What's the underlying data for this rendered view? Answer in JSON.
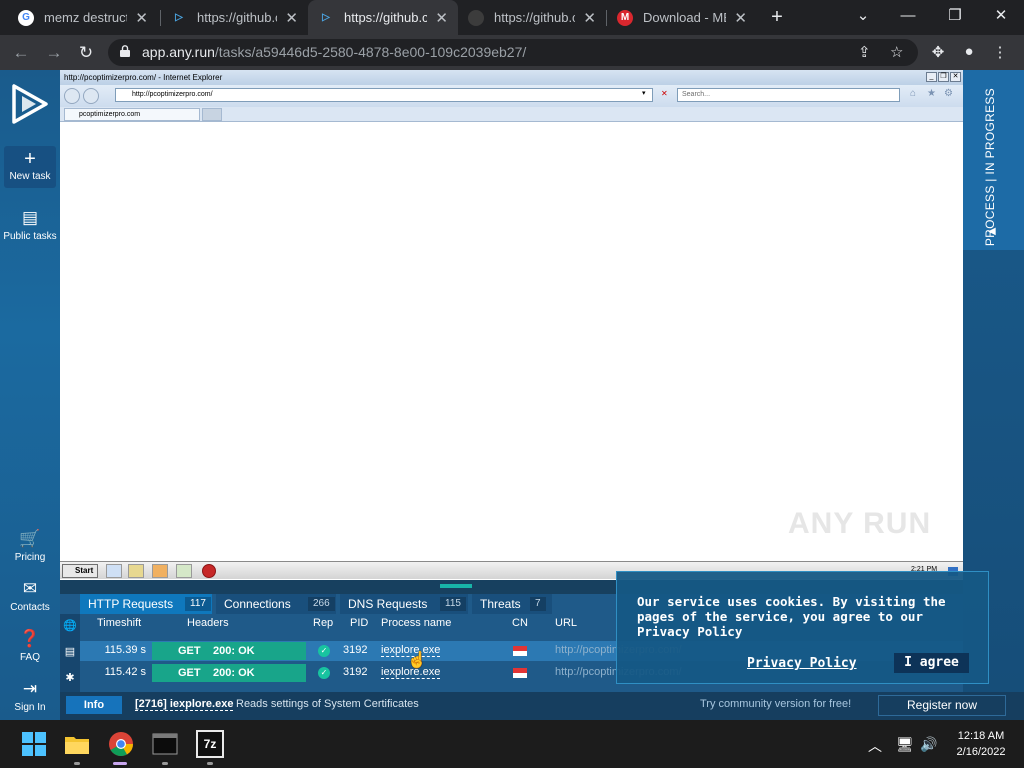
{
  "browser": {
    "tabs": [
      {
        "title": "memz destructi",
        "favicon": "google-icon"
      },
      {
        "title": "https://github.co",
        "favicon": "anyrun-icon"
      },
      {
        "title": "https://github.co",
        "favicon": "anyrun-icon"
      },
      {
        "title": "https://github.co",
        "favicon": "github-icon"
      },
      {
        "title": "Download - ME",
        "favicon": "mega-icon"
      }
    ],
    "active_tab_index": 2,
    "address": {
      "host": "app.any.run",
      "path": "/tasks/a59446d5-2580-4878-8e00-109c2039eb27/"
    }
  },
  "sidebar": {
    "new_task": "New task",
    "public_tasks": "Public tasks",
    "pricing": "Pricing",
    "contacts": "Contacts",
    "faq": "FAQ",
    "sign_in": "Sign In"
  },
  "process_strip": {
    "label": "PROCESS | IN PROGRESS"
  },
  "vm": {
    "ie_title": "http://pcoptimizerpro.com/ - Internet Explorer",
    "ie_url": "http://pcoptimizerpro.com/",
    "ie_search_placeholder": "Search...",
    "ie_tab": "pcoptimizerpro.com",
    "watermark": "ANY RUN",
    "start_label": "Start",
    "clock": "2:21 PM"
  },
  "panel": {
    "tabs": [
      {
        "label": "HTTP Requests",
        "count": "117"
      },
      {
        "label": "Connections",
        "count": "266"
      },
      {
        "label": "DNS Requests",
        "count": "115"
      },
      {
        "label": "Threats",
        "count": "7"
      }
    ],
    "columns": {
      "timeshift": "Timeshift",
      "headers": "Headers",
      "rep": "Rep",
      "pid": "PID",
      "process": "Process name",
      "cn": "CN",
      "url": "URL"
    },
    "rows": [
      {
        "time": "115.39 s",
        "method": "GET",
        "status": "200: OK",
        "pid": "3192",
        "process": "iexplore.exe",
        "url": "http://pcoptimizerpro.com/"
      },
      {
        "time": "115.42 s",
        "method": "GET",
        "status": "200: OK",
        "pid": "3192",
        "process": "iexplore.exe",
        "url": "http://pcoptimizerpro.com/"
      }
    ]
  },
  "statusbar": {
    "info": "Info",
    "process": "[2716] iexplore.exe",
    "message": "Reads settings of System Certificates",
    "community": "Try community version for free!",
    "register": "Register now"
  },
  "cookie": {
    "message": "Our service uses cookies. By visiting the pages of the service, you agree to our Privacy Policy",
    "policy_link": "Privacy Policy",
    "agree": "I agree"
  },
  "taskbar": {
    "time": "12:18 AM",
    "date": "2/16/2022",
    "apps": [
      "windows-start-icon",
      "file-explorer-icon",
      "chrome-icon",
      "terminal-icon",
      "7zip-icon"
    ],
    "sevenzip_label": "7z"
  },
  "colors": {
    "anyrun_blue": "#1b6aa0",
    "get_green": "#18a58a",
    "chrome_dark": "#202124"
  }
}
